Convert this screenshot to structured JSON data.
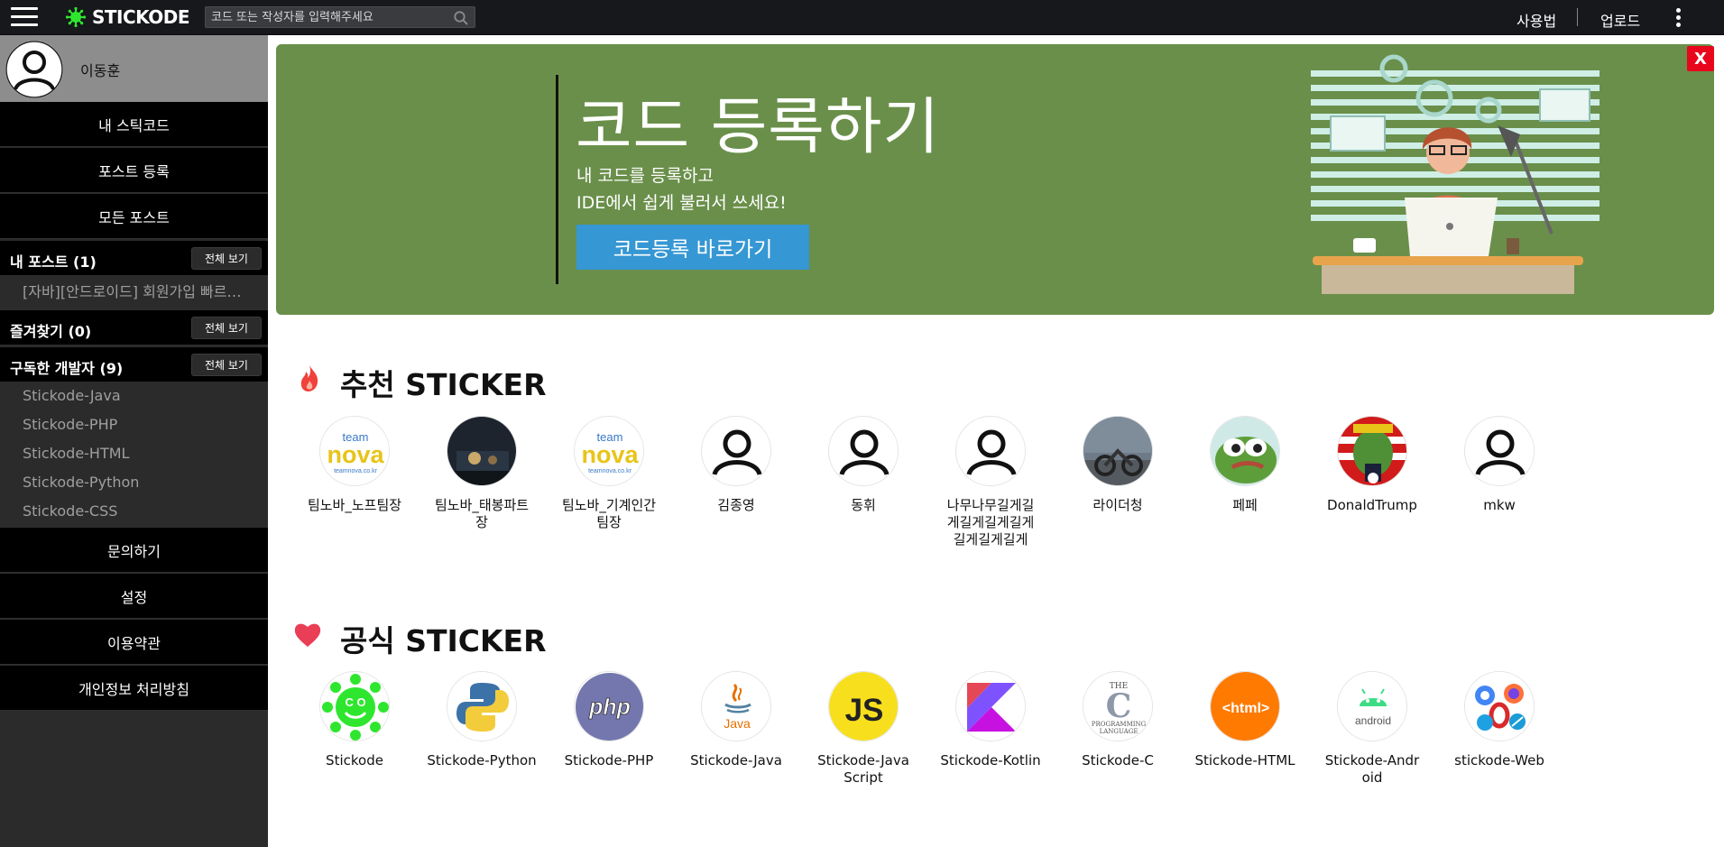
{
  "topbar": {
    "logo_text": "STICKODE",
    "search_placeholder": "코드 또는 작성자를 입력해주세요",
    "usage_label": "사용법",
    "upload_label": "업로드"
  },
  "sidebar": {
    "user_name": "이동훈",
    "nav_top": [
      "내 스틱코드",
      "포스트 등록",
      "모든 포스트"
    ],
    "my_posts": {
      "label": "내 포스트 (1)",
      "view_all": "전체 보기",
      "items": [
        "[자바][안드로이드] 회원가입 빠르게 만들기"
      ]
    },
    "favorites": {
      "label": "즐겨찾기 (0)",
      "view_all": "전체 보기"
    },
    "subscribed": {
      "label": "구독한 개발자 (9)",
      "view_all": "전체 보기",
      "items": [
        "Stickode-Java",
        "Stickode-PHP",
        "Stickode-HTML",
        "Stickode-Python",
        "Stickode-CSS"
      ]
    },
    "nav_bottom": [
      "문의하기",
      "설정",
      "이용약관",
      "개인정보 처리방침"
    ]
  },
  "banner": {
    "title": "코드 등록하기",
    "line1": "내 코드를 등록하고",
    "line2": "IDE에서 쉽게 불러서 쓰세요!",
    "button": "코드등록 바로가기",
    "close": "X"
  },
  "recommended": {
    "title": "추천 STICKER",
    "items": [
      {
        "name": "팀노바_노프팀장",
        "avatar": "teamnova-logo"
      },
      {
        "name": "팀노바_태봉파트장",
        "avatar": "dark-photo"
      },
      {
        "name": "팀노바_기계인간팀장",
        "avatar": "teamnova-logo"
      },
      {
        "name": "김종영",
        "avatar": "person-icon"
      },
      {
        "name": "동휘",
        "avatar": "person-icon"
      },
      {
        "name": "나무나무길게길게길게길게길게길게길게길게",
        "avatar": "person-icon"
      },
      {
        "name": "라이더청",
        "avatar": "motorcycle-photo"
      },
      {
        "name": "페페",
        "avatar": "pepe-frog"
      },
      {
        "name": "DonaldTrump",
        "avatar": "trump-frog"
      },
      {
        "name": "mkw",
        "avatar": "person-icon"
      }
    ]
  },
  "official": {
    "title": "공식 STICKER",
    "items": [
      {
        "name": "Stickode",
        "avatar": "stickode-logo"
      },
      {
        "name": "Stickode-Python",
        "avatar": "python-logo"
      },
      {
        "name": "Stickode-PHP",
        "avatar": "php-logo"
      },
      {
        "name": "Stickode-Java",
        "avatar": "java-logo"
      },
      {
        "name": "Stickode-JavaScript",
        "avatar": "javascript-logo"
      },
      {
        "name": "Stickode-Kotlin",
        "avatar": "kotlin-logo"
      },
      {
        "name": "Stickode-C",
        "avatar": "c-logo"
      },
      {
        "name": "Stickode-HTML",
        "avatar": "html-logo"
      },
      {
        "name": "Stickode-Android",
        "avatar": "android-logo"
      },
      {
        "name": "stickode-Web",
        "avatar": "web-browsers-logo"
      }
    ]
  },
  "colors": {
    "topbar_bg": "#17181c",
    "banner_bg": "#6a8f4a",
    "banner_button": "#3597d3",
    "close_button": "#e8061d",
    "stickode_green": "#2ee62e"
  }
}
